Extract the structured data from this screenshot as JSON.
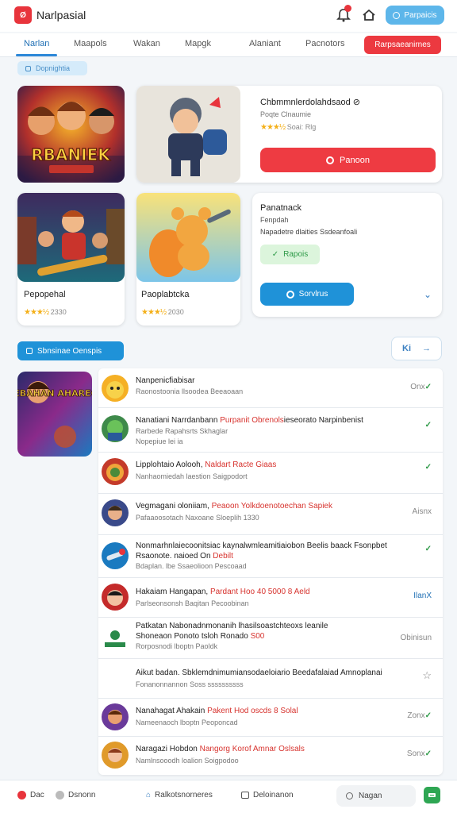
{
  "colors": {
    "accent": "#1f92d8",
    "brand_red": "#e8343c",
    "success": "#2e9a48",
    "star": "#f4b019"
  },
  "header": {
    "logo_text": "Ø",
    "app_title": "Narlpasial",
    "notification_icon": "bell-icon",
    "home_icon": "home-icon",
    "action_label": "Parpaicis"
  },
  "tabs": {
    "items": [
      {
        "label": "Narlan"
      },
      {
        "label": "Maapols"
      },
      {
        "label": "Wakan"
      },
      {
        "label": "Mapgk"
      },
      {
        "label": "Alaniant"
      },
      {
        "label": "Pacnotors"
      }
    ],
    "cta_label": "Rarpsaeanirnes"
  },
  "section1": {
    "label": "Dopnightia"
  },
  "featured": {
    "title": "Chbmmnlerdolahdsaod ⊘",
    "subtitle": "Poqte Clnaumie",
    "stars": "★★★½",
    "rating_text": "Soai: Rlg",
    "button_label": "Panoon",
    "art_text": "RBANIEK"
  },
  "detail": {
    "title": "Panatnack",
    "subtitle1": "Fenpdah",
    "subtitle2": "Napadetre dlaities Ssdeanfoali",
    "badge_label": "Rapois",
    "button_label": "Sorvlrus"
  },
  "tiles": [
    {
      "name": "Pepopehal",
      "stars": "★★★½",
      "rating": "2330"
    },
    {
      "name": "Paoplabtcka",
      "stars": "★★★½",
      "rating": "2030"
    }
  ],
  "section2": {
    "label": "Sbnsinae Oenspis",
    "nav_left": "Ki"
  },
  "list_cover": {
    "text": "NEBAHAN AHAREOIS"
  },
  "list_items": [
    {
      "l1": "Nanpenicfiabisar",
      "hl": "",
      "l2": "",
      "meta": "Raonostoonia llsoodea Beeaoaan",
      "status": "Onx",
      "status_style": "grey",
      "check": true
    },
    {
      "l1": "Nanatiani Narrdanbann ",
      "hl": "Purpanit Obrenols",
      "l1b": "ieseorato Narpinbenist",
      "l2": "Rarbede Rapahsrts Skhaglar",
      "meta": "Nopepiue lei ia",
      "status": "",
      "status_style": "green",
      "check": true
    },
    {
      "l1": "Lipplohtaio Aolooh, ",
      "hl": "Naldart Racte Giaas",
      "l1b": "",
      "l2": "",
      "meta": "Nanhaomiedah laestion Saigpodort",
      "status": "",
      "status_style": "green",
      "check": true
    },
    {
      "l1": "Vegmagani oloniiam, ",
      "hl": "Peaoon Yolkdoenotoechan Sapiek",
      "l1b": "",
      "l2": "",
      "meta": "Pafaaoosotach Naxoane Sloeplih 1330",
      "status": "Aisnx",
      "status_style": "grey",
      "check": false
    },
    {
      "l1": "Nonmarhnlaiecoonitsiac kaynalwmleamitiaiobon Beelis baack Fsonpbet",
      "hl": "",
      "l1b": "",
      "l2": "Rsaonote. naioed On ",
      "l2hl": "Debilt",
      "meta": "Bdaplan. lbe Ssaeolioon Pescoaad",
      "status": "",
      "status_style": "green",
      "check": true
    },
    {
      "l1": "Hakaiam Hangapan, ",
      "hl": "Pardant Hoo 40 5000 8 Aeld",
      "l1b": "",
      "l2": "",
      "meta": "Parlseonsonsh Baqitan Pecoobinan",
      "status": "IlanX",
      "status_style": "blue",
      "check": false
    },
    {
      "l1": "Patkatan Nabonadnmonanih lhasilsoastchteoxs leanile",
      "hl": "",
      "l1b": "",
      "l2": "Shoneaon Ponoto tsloh Ronado ",
      "l2hl": "S00",
      "meta": "Rorposnodi lboptn Paoldk",
      "status": "Obinisun",
      "status_style": "grey",
      "check": true
    },
    {
      "l1": "Aikut badan. Sbklemdnimumiansodaeloiario Beedafalaiad Amnoplanai",
      "hl": "",
      "l1b": "",
      "l2": "",
      "meta": "Fonanonnannon Soss ssssssssss",
      "status": "",
      "status_style": "grey",
      "check": false
    },
    {
      "l1": "Nanahagat Ahakain ",
      "hl": "Pakent Hod oscds 8 Solal",
      "l1b": "",
      "l2": "",
      "meta": "Nameenaoch lboptn Peoponcad",
      "status": "Zonx",
      "status_style": "grey",
      "check": true
    },
    {
      "l1": "Naragazi Hobdon ",
      "hl": "Nangorg Korof Amnar Oslsals",
      "l1b": "",
      "l2": "",
      "meta": "Namlnsooodh loalion Soigpodoo",
      "status": "Sonx",
      "status_style": "grey",
      "check": true
    }
  ],
  "footer": {
    "item1": "Dac",
    "item2": "Dsnonn",
    "item3": "Ralkotsnorneres",
    "item4": "Deloinanon",
    "search_label": "Nagan"
  }
}
